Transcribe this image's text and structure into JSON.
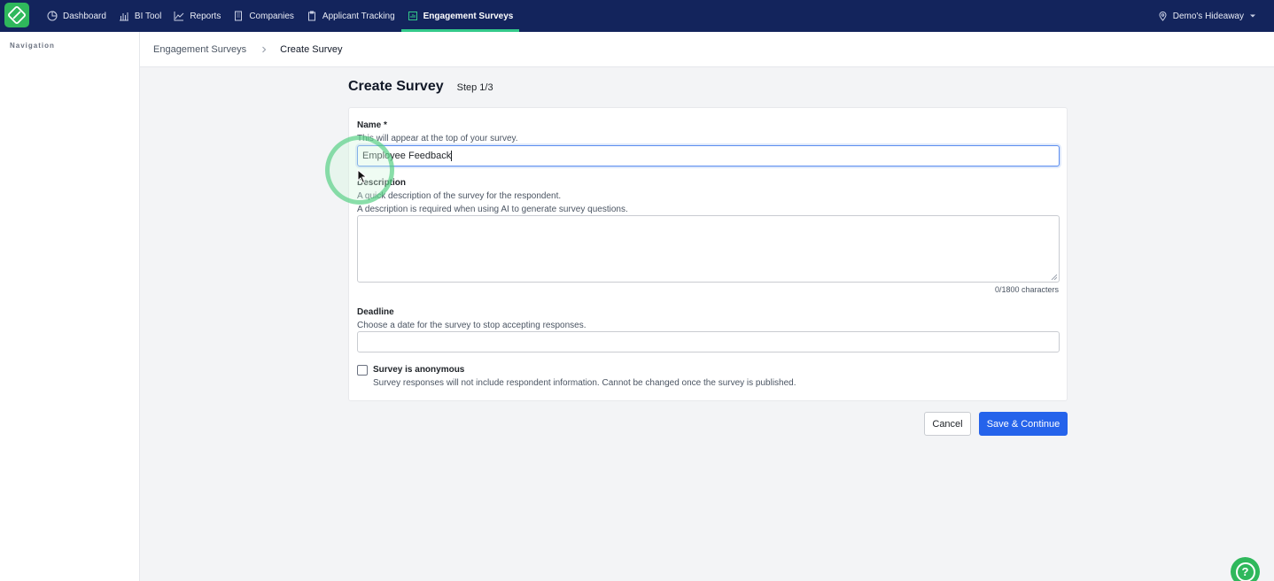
{
  "app": {
    "brand_color": "#2fb85c",
    "nav_bg": "#13245c",
    "active_indicator": "#33c98a",
    "primary_color": "#2563eb"
  },
  "topnav": {
    "items": [
      {
        "label": "Dashboard",
        "icon": "dashboard-icon"
      },
      {
        "label": "BI Tool",
        "icon": "bar-chart-icon"
      },
      {
        "label": "Reports",
        "icon": "trend-line-icon"
      },
      {
        "label": "Companies",
        "icon": "building-icon"
      },
      {
        "label": "Applicant Tracking",
        "icon": "clipboard-icon"
      },
      {
        "label": "Engagement Surveys",
        "icon": "survey-icon",
        "active": true
      }
    ],
    "account_label": "Demo's Hideaway"
  },
  "sidebar": {
    "title": "Navigation"
  },
  "breadcrumb": {
    "parent": "Engagement Surveys",
    "current": "Create Survey"
  },
  "page": {
    "title": "Create Survey",
    "step": "Step 1/3"
  },
  "form": {
    "name": {
      "label": "Name *",
      "help": "This will appear at the top of your survey.",
      "value": "Employee Feedback"
    },
    "description": {
      "label": "Description",
      "help_1": "A quick description of the survey for the respondent.",
      "help_2": "A description is required when using AI to generate survey questions.",
      "value": "",
      "char_count": "0/1800 characters"
    },
    "deadline": {
      "label": "Deadline",
      "help": "Choose a date for the survey to stop accepting responses.",
      "value": ""
    },
    "anonymous": {
      "label": "Survey is anonymous",
      "help": "Survey responses will not include respondent information. Cannot be changed once the survey is published.",
      "checked": false
    }
  },
  "actions": {
    "cancel": "Cancel",
    "save": "Save & Continue"
  },
  "help_button": {
    "glyph": "?"
  }
}
